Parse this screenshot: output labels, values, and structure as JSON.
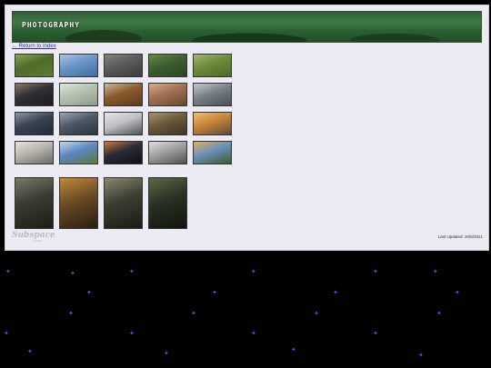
{
  "header": {
    "title": "PHOTOGRAPHY"
  },
  "nav": {
    "return_label": "← Return to Index"
  },
  "gallery": {
    "rows": [
      [
        {
          "name": "thumb-plants",
          "colors": [
            "#4d6b2a",
            "#8aa64a",
            "#5f7d33"
          ]
        },
        {
          "name": "thumb-sea-sky",
          "colors": [
            "#6b94c6",
            "#a9c5e6",
            "#3a6e9c"
          ]
        },
        {
          "name": "thumb-dock",
          "colors": [
            "#5a5a5a",
            "#8b8177",
            "#3d3d3d"
          ]
        },
        {
          "name": "thumb-garden",
          "colors": [
            "#3c5f2d",
            "#6a8a45",
            "#2d4523"
          ]
        },
        {
          "name": "thumb-leaf-hand",
          "colors": [
            "#6c8a3a",
            "#a7b67c",
            "#4a6a2a"
          ]
        }
      ],
      [
        {
          "name": "thumb-sunset-dark",
          "colors": [
            "#2e2e33",
            "#8a7a66",
            "#1c1c22"
          ]
        },
        {
          "name": "thumb-fog-figure",
          "colors": [
            "#b5c0b0",
            "#dfe6da",
            "#8d9a89"
          ]
        },
        {
          "name": "thumb-keyboard",
          "colors": [
            "#8a5a2a",
            "#c9b8a0",
            "#5c3a1c"
          ]
        },
        {
          "name": "thumb-cat",
          "colors": [
            "#a07050",
            "#d7b08a",
            "#6a4a30"
          ]
        },
        {
          "name": "thumb-car",
          "colors": [
            "#7a8088",
            "#c5cad0",
            "#4a5056"
          ]
        }
      ],
      [
        {
          "name": "thumb-lake-dusk",
          "colors": [
            "#3a4456",
            "#8d94a0",
            "#202834"
          ]
        },
        {
          "name": "thumb-building",
          "colors": [
            "#4c5866",
            "#9aa6b3",
            "#2c3540"
          ]
        },
        {
          "name": "thumb-camera-lens",
          "colors": [
            "#c0c0c6",
            "#e6e6ea",
            "#505058"
          ]
        },
        {
          "name": "thumb-wood-pile",
          "colors": [
            "#6a5a3a",
            "#a99470",
            "#3e3424"
          ]
        },
        {
          "name": "thumb-orange-sunset",
          "colors": [
            "#c7843a",
            "#f0c070",
            "#5a4a3a"
          ]
        }
      ],
      [
        {
          "name": "thumb-polaroids",
          "colors": [
            "#b7b4ae",
            "#e8e4dc",
            "#6c6a66"
          ]
        },
        {
          "name": "thumb-field-sky",
          "colors": [
            "#5a86c0",
            "#c6d8ea",
            "#5a7a3a"
          ]
        },
        {
          "name": "thumb-reflection",
          "colors": [
            "#2a2a3a",
            "#d07a3a",
            "#101018"
          ]
        },
        {
          "name": "thumb-pencils",
          "colors": [
            "#a0a0a0",
            "#e0e0e0",
            "#505050"
          ]
        },
        {
          "name": "thumb-tree-sunset",
          "colors": [
            "#6a90c0",
            "#e0b060",
            "#3a5a2a"
          ]
        }
      ],
      [
        {
          "name": "thumb-forest-1",
          "colors": [
            "#3a3a32",
            "#7a7a66",
            "#1e1e18"
          ]
        },
        {
          "name": "thumb-forest-autumn",
          "colors": [
            "#6a4a24",
            "#c08a3a",
            "#2a1e10"
          ]
        },
        {
          "name": "thumb-forest-path",
          "colors": [
            "#3c3c30",
            "#8a8a70",
            "#1c1c16"
          ]
        },
        {
          "name": "thumb-forest-bridge",
          "colors": [
            "#2a3022",
            "#5a6a44",
            "#12160e"
          ]
        }
      ]
    ]
  },
  "footer": {
    "logo_text": "Subspace",
    "logo_sub": "studios",
    "last_updated": "Last Updated: 20/6/2021"
  }
}
